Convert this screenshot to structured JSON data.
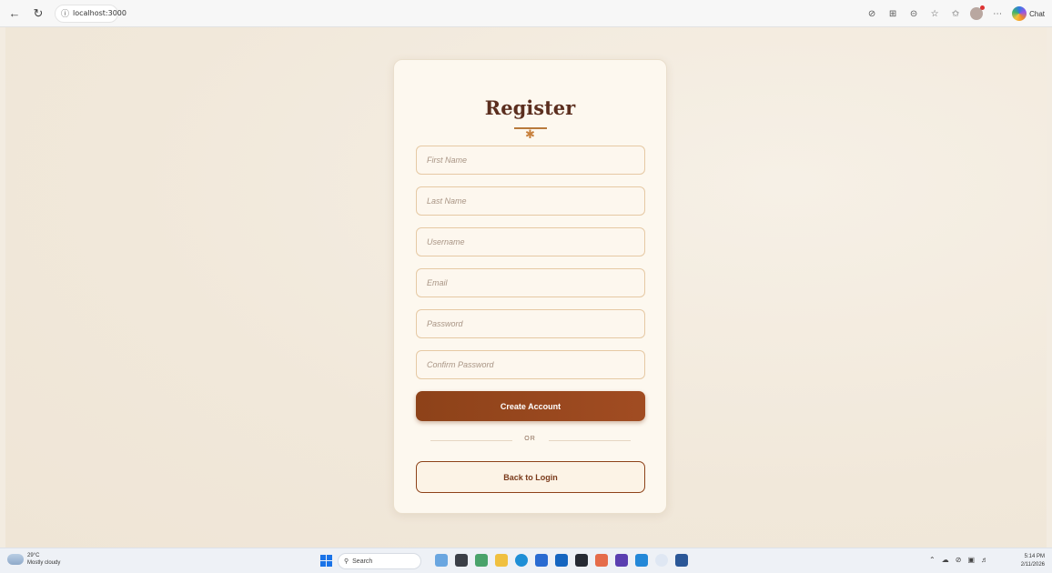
{
  "browser": {
    "url": "localhost:3000",
    "chat_label": "Chat",
    "icons": [
      "back-arrow-icon",
      "reload-icon",
      "info-icon",
      "tracking-icon",
      "split-screen-icon",
      "zoom-icon",
      "favorite-star-icon",
      "favorites-list-icon",
      "profile-icon",
      "more-icon",
      "copilot-icon"
    ]
  },
  "register": {
    "title": "Register",
    "first_name_placeholder": "First Name",
    "last_name_placeholder": "Last Name",
    "username_placeholder": "Username",
    "email_placeholder": "Email",
    "password_placeholder": "Password",
    "confirm_password_placeholder": "Confirm Password",
    "create_button": "Create Account",
    "divider_text": "OR",
    "back_button": "Back to Login",
    "colors": {
      "title": "#5b2e1e",
      "primary_button": "#8d4219",
      "accent": "#c8813e",
      "background": "#f3ece1"
    }
  },
  "taskbar": {
    "weather_temp": "29°C",
    "weather_desc": "Mostly cloudy",
    "search_label": "Search",
    "time": "5:14 PM",
    "date": "2/11/2026"
  }
}
